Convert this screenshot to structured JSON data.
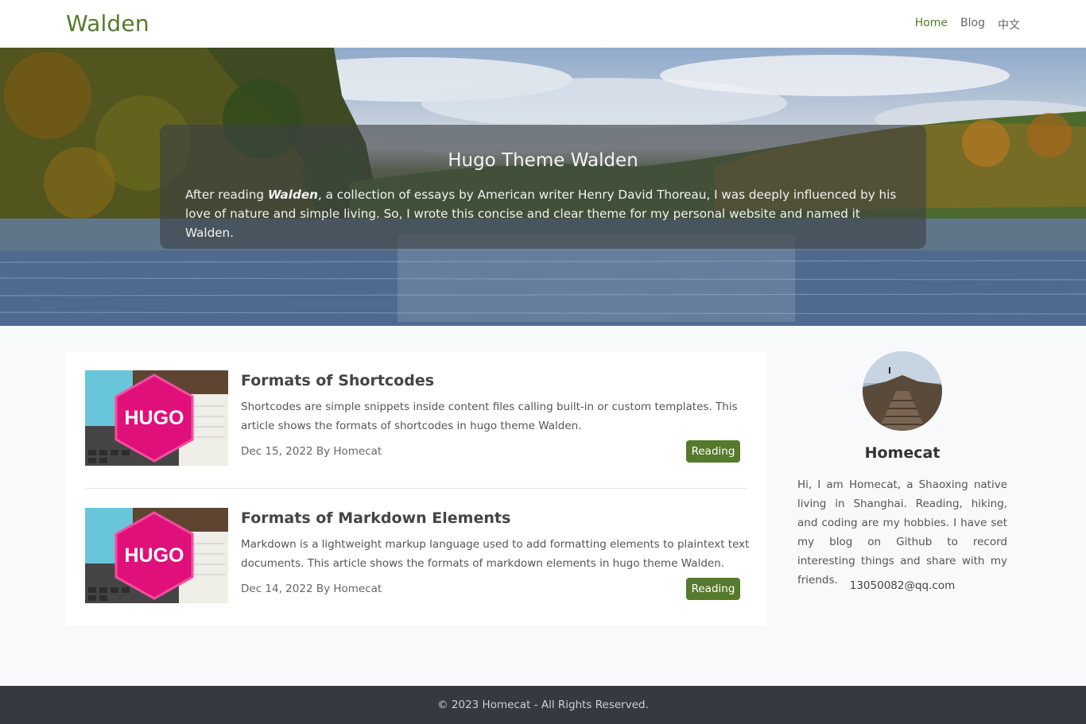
{
  "navbar": {
    "brand": "Walden",
    "links": [
      {
        "label": "Home",
        "active": true
      },
      {
        "label": "Blog",
        "active": false
      },
      {
        "label": "中文",
        "active": false
      }
    ]
  },
  "hero": {
    "title": "Hugo Theme Walden",
    "text_before": "After reading ",
    "text_bold": "Walden",
    "text_after": ", a collection of essays by American writer Henry David Thoreau, I was deeply influenced by his love of nature and simple living. So, I wrote this concise and clear theme for my personal website and named it Walden."
  },
  "posts": [
    {
      "title": "Formats of Shortcodes",
      "summary": "Shortcodes are simple snippets inside content files calling built-in or custom templates. This article shows the formats of shortcodes in hugo theme Walden.",
      "meta": "Dec 15, 2022 By Homecat",
      "button": "Reading",
      "thumb_label": "HUGO"
    },
    {
      "title": "Formats of Markdown Elements",
      "summary": "Markdown is a lightweight markup language used to add formatting elements to plaintext text documents. This article shows the formats of markdown elements in hugo theme Walden.",
      "meta": "Dec 14, 2022 By Homecat",
      "button": "Reading",
      "thumb_label": "HUGO"
    }
  ],
  "sidebar": {
    "name": "Homecat",
    "bio": "Hi, I am Homecat, a Shaoxing native living in Shanghai. Reading, hiking, and coding are my hobbies. I have set my blog on Github to record interesting things and share with my friends.",
    "email": "13050082@qq.com"
  },
  "footer": {
    "text": "© 2023 Homecat - All Rights Reserved."
  },
  "colors": {
    "accent": "#557a2b",
    "footer_bg": "#343a40",
    "hugo_pink": "#e0107a"
  }
}
